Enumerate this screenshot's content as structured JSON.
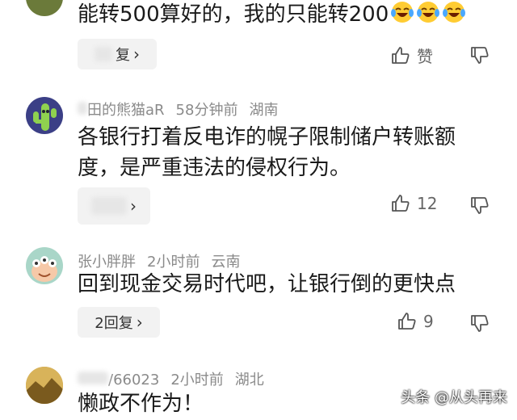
{
  "comments": [
    {
      "text": "能转500算好的，我的只能转200",
      "reply_label": "复",
      "like_label": "赞"
    },
    {
      "username": "田的熊猫aR",
      "time": "58分钟前",
      "location": "湖南",
      "text_line1": "各银行打着反电诈的幌子限制储户转账额",
      "text_line2": "度，是严重违法的侵权行为。",
      "likes": "12"
    },
    {
      "username": "张小胖胖",
      "time": "2小时前",
      "location": "云南",
      "text": "回到现金交易时代吧，让银行倒的更快点",
      "reply_label": "2回复",
      "likes": "9"
    },
    {
      "username": "/66023",
      "time": "2小时前",
      "location": "湖北",
      "text": "懒政不作为！"
    }
  ],
  "watermark": "头条 @从头再来",
  "icons": [
    "chevron-right-icon",
    "thumb-up-icon",
    "thumb-down-icon",
    "laughing-tears-emoji"
  ]
}
